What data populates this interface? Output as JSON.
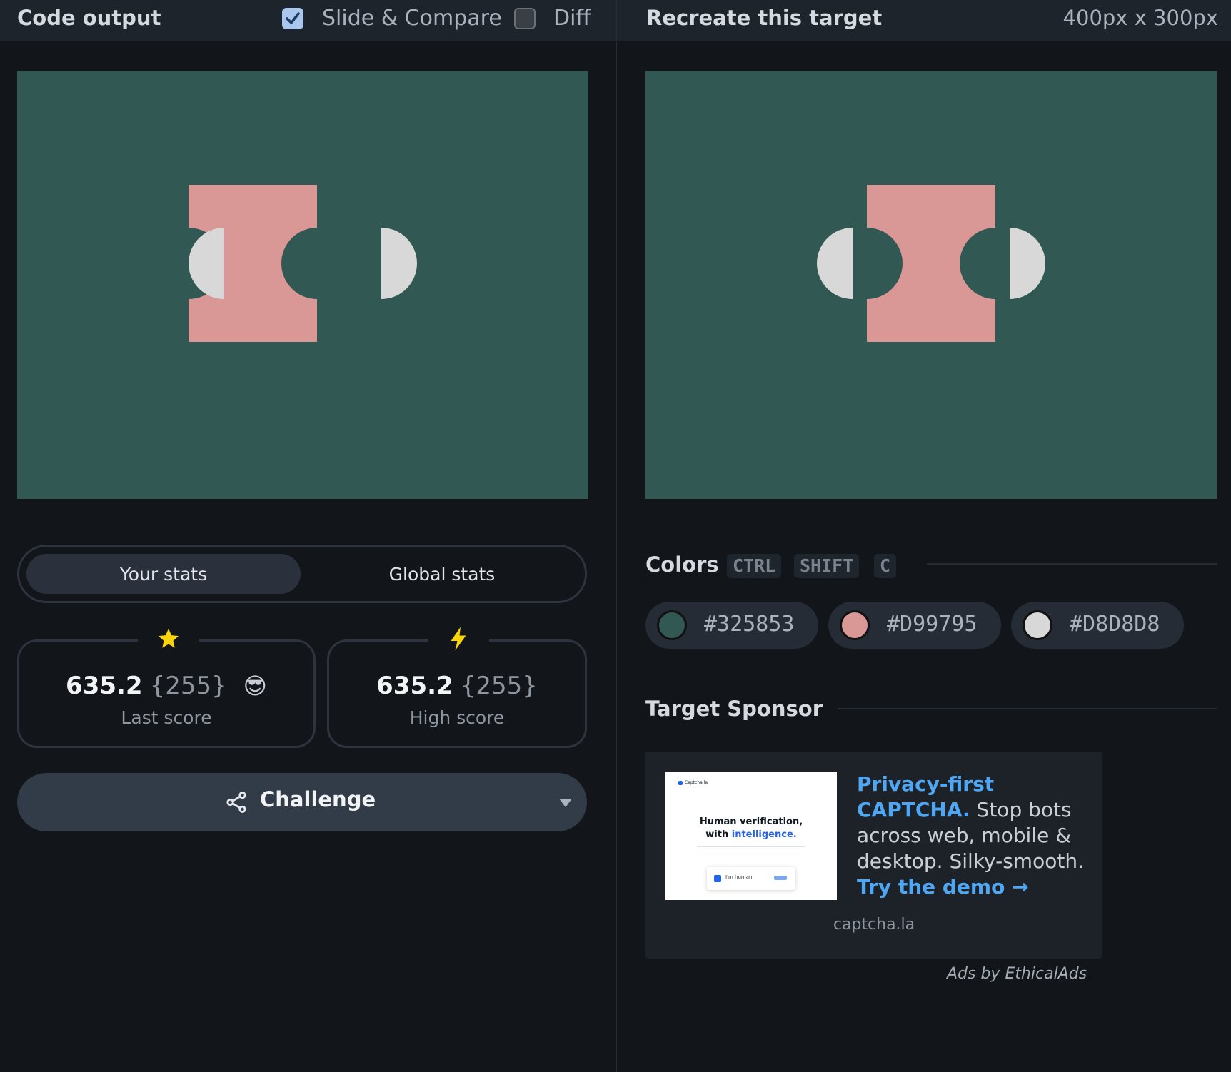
{
  "left_panel": {
    "title": "Code output",
    "slide_compare": {
      "label": "Slide & Compare",
      "checked": true
    },
    "diff": {
      "label": "Diff",
      "checked": false
    }
  },
  "right_panel": {
    "title": "Recreate this target",
    "dimensions": "400px x 300px"
  },
  "stats": {
    "tabs": [
      {
        "label": "Your stats",
        "active": true
      },
      {
        "label": "Global stats",
        "active": false
      }
    ],
    "last_score": {
      "value": "635.2",
      "chars": "{255}",
      "label": "Last score",
      "icon": "star-icon",
      "emoji": "😎"
    },
    "high_score": {
      "value": "635.2",
      "chars": "{255}",
      "label": "High score",
      "icon": "lightning-icon"
    }
  },
  "challenge": {
    "label": "Challenge",
    "icon": "share-icon"
  },
  "colors_section": {
    "title": "Colors",
    "shortcut": [
      "CTRL",
      "SHIFT",
      "C"
    ],
    "swatches": [
      {
        "hex": "#325853"
      },
      {
        "hex": "#D99795"
      },
      {
        "hex": "#D8D8D8"
      }
    ]
  },
  "sponsor": {
    "title": "Target Sponsor",
    "ad": {
      "image_brand": "Captcha.la",
      "image_headline": "Human verification,",
      "image_headline2_prefix": "with ",
      "image_headline2_accent": "intelligence.",
      "image_checkbox_label": "I'm human",
      "headline": "Privacy-first CAPTCHA.",
      "body": " Stop bots across web, mobile & desktop. Silky-smooth. ",
      "cta": "Try the demo →",
      "domain": "captcha.la"
    },
    "attribution": "Ads by EthicalAds"
  },
  "target_colors": {
    "background": "#325853",
    "primary": "#D99795",
    "secondary": "#D8D8D8"
  }
}
